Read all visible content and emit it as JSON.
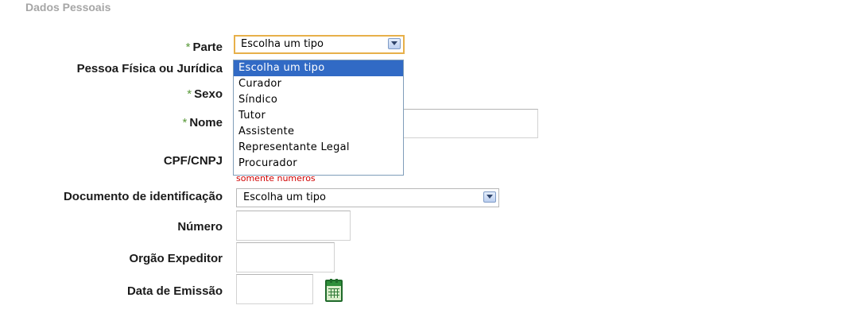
{
  "top_fragment": "",
  "fieldset": {
    "legend": "Dados Pessoais"
  },
  "form": {
    "parte": {
      "label": "Parte",
      "value": "Escolha um tipo"
    },
    "pessoa": {
      "label": "Pessoa Física ou Jurídica"
    },
    "sexo": {
      "label": "Sexo"
    },
    "nome": {
      "label": "Nome",
      "value": ""
    },
    "cpf": {
      "label": "CPF/CNPJ",
      "hint": "somente números"
    },
    "documento": {
      "label": "Documento de identificação",
      "value": "Escolha um tipo"
    },
    "numero": {
      "label": "Número",
      "value": ""
    },
    "orgao": {
      "label": "Orgão Expeditor",
      "value": ""
    },
    "data_emissao": {
      "label": "Data de Emissão",
      "value": ""
    }
  },
  "dropdown": {
    "options": [
      "Escolha um tipo",
      "Curador",
      "Síndico",
      "Tutor",
      "Assistente",
      "Representante Legal",
      "Procurador"
    ],
    "selected_index": 0
  },
  "icons": {
    "required": "asterisk-icon",
    "calendar": "calendar-icon",
    "dropdown_arrow": "chevron-down-icon"
  },
  "colors": {
    "required": "#5a9a3a",
    "hint": "#d00000",
    "focus_border": "#e7b04a",
    "selected_option": "#316ac5",
    "legend": "#a6a6a6"
  }
}
